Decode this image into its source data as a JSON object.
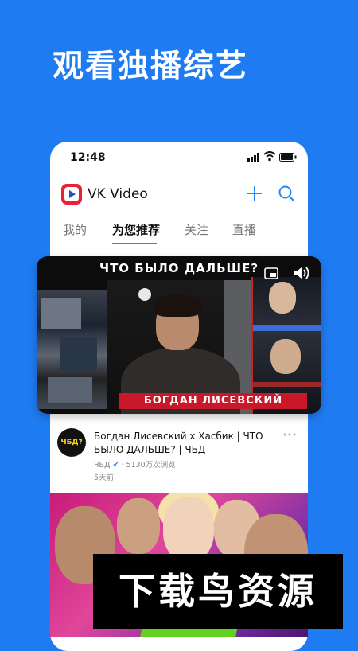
{
  "headline": "观看独播综艺",
  "status_bar": {
    "time": "12:48"
  },
  "app": {
    "title": "VK Video"
  },
  "tabs": [
    {
      "label": "我的",
      "active": false
    },
    {
      "label": "为您推荐",
      "active": true
    },
    {
      "label": "关注",
      "active": false
    },
    {
      "label": "直播",
      "active": false
    }
  ],
  "video": {
    "overlay_top": "ЧТО БЫЛО ДАЛЬШЕ?",
    "overlay_bottom": "БОГДАН ЛИСЕВСКИЙ",
    "channel_logo_text": "ЧБД?",
    "title": "Богдан Лисевский х Хасбик | ЧТО БЫЛО ДАЛЬШЕ? | ЧБД",
    "channel": "ЧБД",
    "views": "5130万次浏览",
    "age": "5天前"
  },
  "watermark": "下载鸟资源",
  "colors": {
    "background": "#1f7bf2",
    "accent": "#2787f5",
    "brand_red": "#e6213a"
  },
  "icons": [
    "signal-icon",
    "wifi-icon",
    "battery-icon",
    "vk-video-logo-icon",
    "plus-icon",
    "search-icon",
    "pip-icon",
    "sound-icon",
    "more-options-icon",
    "verified-icon"
  ]
}
